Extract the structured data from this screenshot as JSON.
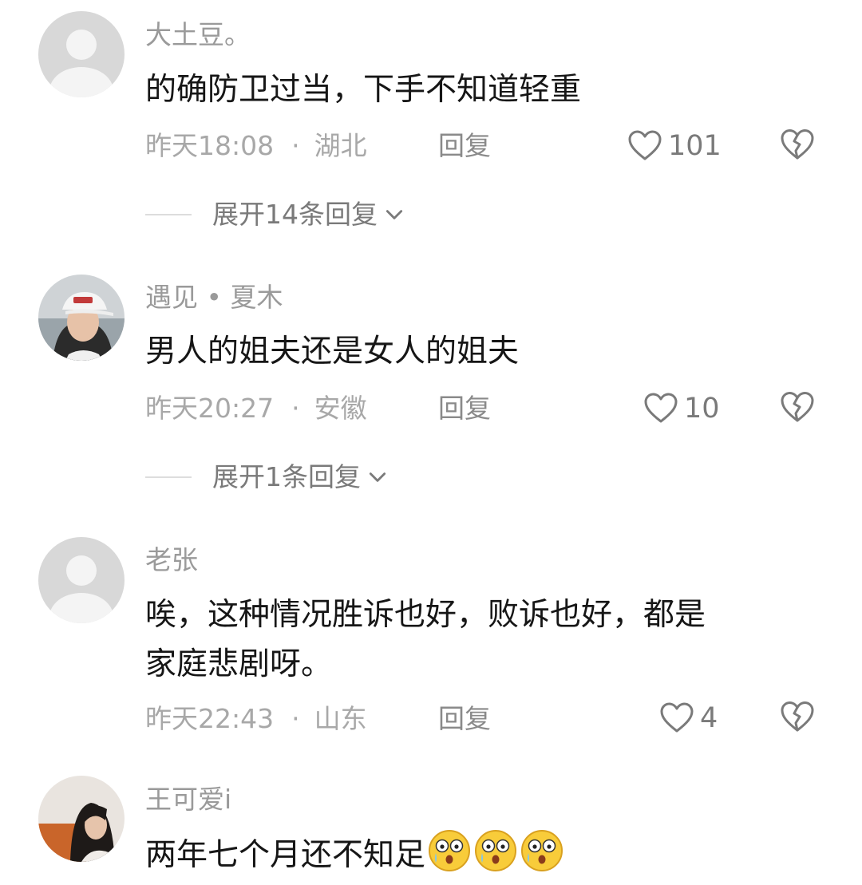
{
  "colors": {
    "username": "#9a9a9a",
    "content": "#161616",
    "meta": "#a8a8a8",
    "action": "#7a7a7a",
    "divider": "#dddddd"
  },
  "icons": {
    "like": "heart-outline-icon",
    "dislike": "broken-heart-icon",
    "expand": "chevron-down-icon",
    "emoji": "surprised-face-emoji"
  },
  "comments": [
    {
      "username": "大土豆。",
      "avatar": "default-avatar",
      "lines": [
        "的确防卫过当，下手不知道轻重"
      ],
      "time": "昨天18:08",
      "separator": "·",
      "location": "湖北",
      "reply_label": "回复",
      "likes": "101",
      "expand_label": "展开14条回复"
    },
    {
      "username": "遇见 • 夏木",
      "avatar": "photo-avatar-white-cap",
      "lines": [
        "男人的姐夫还是女人的姐夫"
      ],
      "time": "昨天20:27",
      "separator": "·",
      "location": "安徽",
      "reply_label": "回复",
      "likes": "10",
      "expand_label": "展开1条回复"
    },
    {
      "username": "老张",
      "avatar": "default-avatar",
      "lines": [
        "唉，这种情况胜诉也好，败诉也好，都是",
        "家庭悲剧呀。"
      ],
      "time": "昨天22:43",
      "separator": "·",
      "location": "山东",
      "reply_label": "回复",
      "likes": "4"
    },
    {
      "username": "王可爱i",
      "avatar": "photo-avatar-woman",
      "lines": [
        "两年七个月还不知足"
      ],
      "emoji_count": 3
    }
  ]
}
